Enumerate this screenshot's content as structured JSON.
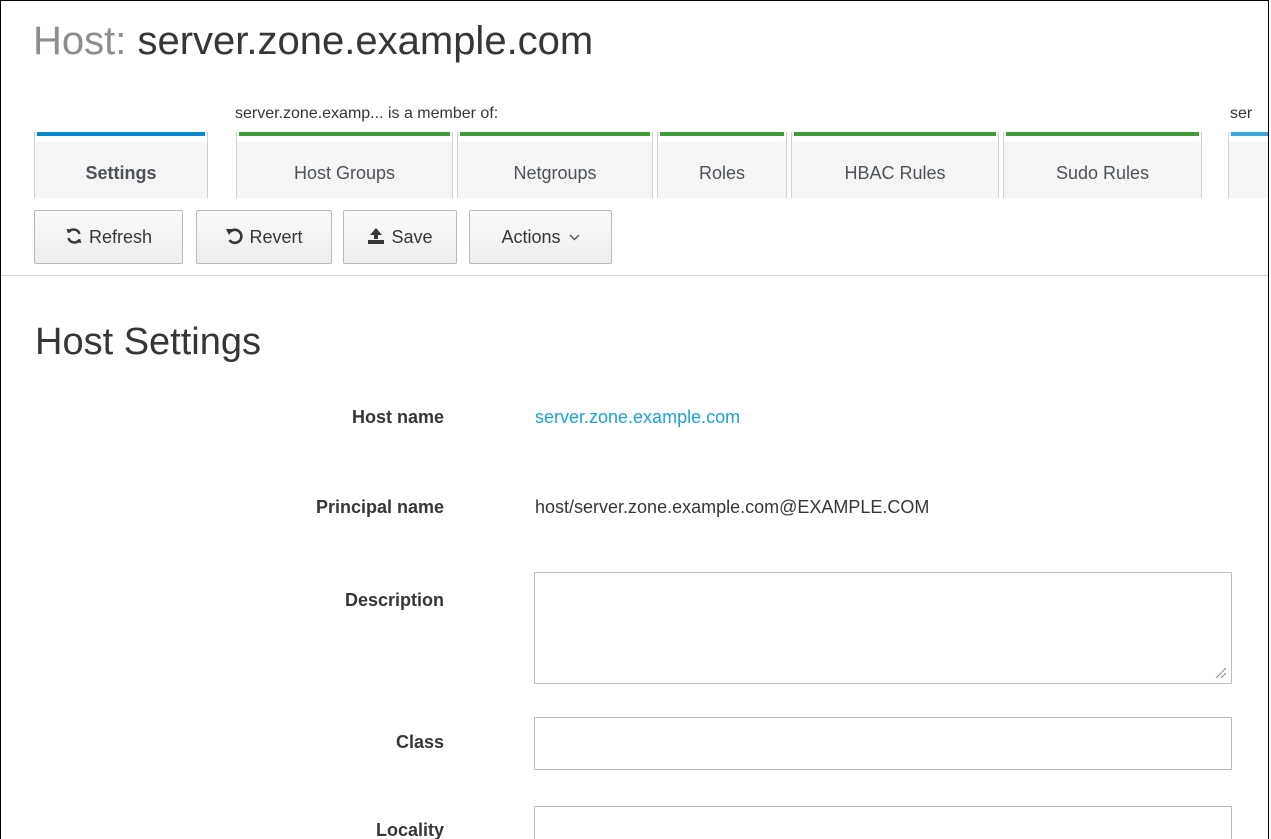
{
  "header": {
    "title_prefix": "Host:",
    "title_name": "server.zone.example.com"
  },
  "member_of_label": "server.zone.examp... is a member of:",
  "member_of_label_2": "ser",
  "tabs": [
    {
      "label": "Settings",
      "active": true
    },
    {
      "label": "Host Groups"
    },
    {
      "label": "Netgroups"
    },
    {
      "label": "Roles"
    },
    {
      "label": "HBAC Rules"
    },
    {
      "label": "Sudo Rules"
    }
  ],
  "toolbar": {
    "refresh_label": "Refresh",
    "revert_label": "Revert",
    "save_label": "Save",
    "actions_label": "Actions",
    "refresh_icon": "refresh-icon",
    "revert_icon": "undo-icon",
    "save_icon": "upload-icon",
    "actions_icon": "chevron-down-icon"
  },
  "section_title": "Host Settings",
  "fields": {
    "host_name": {
      "label": "Host name",
      "value": "server.zone.example.com"
    },
    "principal_name": {
      "label": "Principal name",
      "value": "host/server.zone.example.com@EXAMPLE.COM"
    },
    "description": {
      "label": "Description",
      "value": ""
    },
    "class": {
      "label": "Class",
      "value": ""
    },
    "locality": {
      "label": "Locality",
      "value": ""
    }
  },
  "colors": {
    "link": "#1e9fd8",
    "tab_active_accent": "#0088ce",
    "tab_member_accent": "#3f9c35"
  }
}
